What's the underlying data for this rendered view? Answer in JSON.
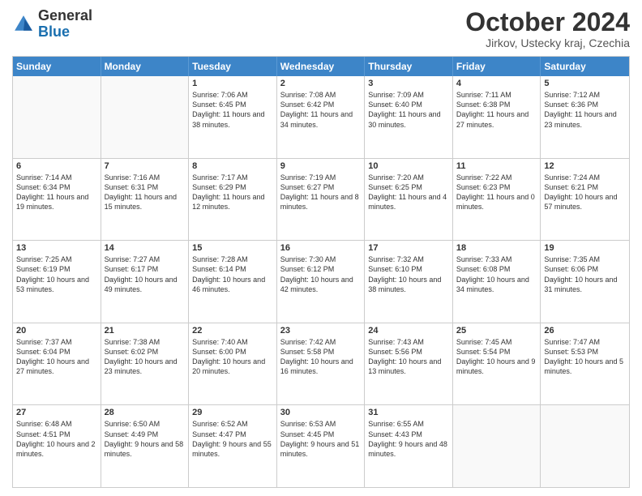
{
  "header": {
    "logo_general": "General",
    "logo_blue": "Blue",
    "month_title": "October 2024",
    "location": "Jirkov, Ustecky kraj, Czechia"
  },
  "days_of_week": [
    "Sunday",
    "Monday",
    "Tuesday",
    "Wednesday",
    "Thursday",
    "Friday",
    "Saturday"
  ],
  "weeks": [
    [
      {
        "day": "",
        "empty": true
      },
      {
        "day": "",
        "empty": true
      },
      {
        "day": "1",
        "sunrise": "Sunrise: 7:06 AM",
        "sunset": "Sunset: 6:45 PM",
        "daylight": "Daylight: 11 hours and 38 minutes."
      },
      {
        "day": "2",
        "sunrise": "Sunrise: 7:08 AM",
        "sunset": "Sunset: 6:42 PM",
        "daylight": "Daylight: 11 hours and 34 minutes."
      },
      {
        "day": "3",
        "sunrise": "Sunrise: 7:09 AM",
        "sunset": "Sunset: 6:40 PM",
        "daylight": "Daylight: 11 hours and 30 minutes."
      },
      {
        "day": "4",
        "sunrise": "Sunrise: 7:11 AM",
        "sunset": "Sunset: 6:38 PM",
        "daylight": "Daylight: 11 hours and 27 minutes."
      },
      {
        "day": "5",
        "sunrise": "Sunrise: 7:12 AM",
        "sunset": "Sunset: 6:36 PM",
        "daylight": "Daylight: 11 hours and 23 minutes."
      }
    ],
    [
      {
        "day": "6",
        "sunrise": "Sunrise: 7:14 AM",
        "sunset": "Sunset: 6:34 PM",
        "daylight": "Daylight: 11 hours and 19 minutes."
      },
      {
        "day": "7",
        "sunrise": "Sunrise: 7:16 AM",
        "sunset": "Sunset: 6:31 PM",
        "daylight": "Daylight: 11 hours and 15 minutes."
      },
      {
        "day": "8",
        "sunrise": "Sunrise: 7:17 AM",
        "sunset": "Sunset: 6:29 PM",
        "daylight": "Daylight: 11 hours and 12 minutes."
      },
      {
        "day": "9",
        "sunrise": "Sunrise: 7:19 AM",
        "sunset": "Sunset: 6:27 PM",
        "daylight": "Daylight: 11 hours and 8 minutes."
      },
      {
        "day": "10",
        "sunrise": "Sunrise: 7:20 AM",
        "sunset": "Sunset: 6:25 PM",
        "daylight": "Daylight: 11 hours and 4 minutes."
      },
      {
        "day": "11",
        "sunrise": "Sunrise: 7:22 AM",
        "sunset": "Sunset: 6:23 PM",
        "daylight": "Daylight: 11 hours and 0 minutes."
      },
      {
        "day": "12",
        "sunrise": "Sunrise: 7:24 AM",
        "sunset": "Sunset: 6:21 PM",
        "daylight": "Daylight: 10 hours and 57 minutes."
      }
    ],
    [
      {
        "day": "13",
        "sunrise": "Sunrise: 7:25 AM",
        "sunset": "Sunset: 6:19 PM",
        "daylight": "Daylight: 10 hours and 53 minutes."
      },
      {
        "day": "14",
        "sunrise": "Sunrise: 7:27 AM",
        "sunset": "Sunset: 6:17 PM",
        "daylight": "Daylight: 10 hours and 49 minutes."
      },
      {
        "day": "15",
        "sunrise": "Sunrise: 7:28 AM",
        "sunset": "Sunset: 6:14 PM",
        "daylight": "Daylight: 10 hours and 46 minutes."
      },
      {
        "day": "16",
        "sunrise": "Sunrise: 7:30 AM",
        "sunset": "Sunset: 6:12 PM",
        "daylight": "Daylight: 10 hours and 42 minutes."
      },
      {
        "day": "17",
        "sunrise": "Sunrise: 7:32 AM",
        "sunset": "Sunset: 6:10 PM",
        "daylight": "Daylight: 10 hours and 38 minutes."
      },
      {
        "day": "18",
        "sunrise": "Sunrise: 7:33 AM",
        "sunset": "Sunset: 6:08 PM",
        "daylight": "Daylight: 10 hours and 34 minutes."
      },
      {
        "day": "19",
        "sunrise": "Sunrise: 7:35 AM",
        "sunset": "Sunset: 6:06 PM",
        "daylight": "Daylight: 10 hours and 31 minutes."
      }
    ],
    [
      {
        "day": "20",
        "sunrise": "Sunrise: 7:37 AM",
        "sunset": "Sunset: 6:04 PM",
        "daylight": "Daylight: 10 hours and 27 minutes."
      },
      {
        "day": "21",
        "sunrise": "Sunrise: 7:38 AM",
        "sunset": "Sunset: 6:02 PM",
        "daylight": "Daylight: 10 hours and 23 minutes."
      },
      {
        "day": "22",
        "sunrise": "Sunrise: 7:40 AM",
        "sunset": "Sunset: 6:00 PM",
        "daylight": "Daylight: 10 hours and 20 minutes."
      },
      {
        "day": "23",
        "sunrise": "Sunrise: 7:42 AM",
        "sunset": "Sunset: 5:58 PM",
        "daylight": "Daylight: 10 hours and 16 minutes."
      },
      {
        "day": "24",
        "sunrise": "Sunrise: 7:43 AM",
        "sunset": "Sunset: 5:56 PM",
        "daylight": "Daylight: 10 hours and 13 minutes."
      },
      {
        "day": "25",
        "sunrise": "Sunrise: 7:45 AM",
        "sunset": "Sunset: 5:54 PM",
        "daylight": "Daylight: 10 hours and 9 minutes."
      },
      {
        "day": "26",
        "sunrise": "Sunrise: 7:47 AM",
        "sunset": "Sunset: 5:53 PM",
        "daylight": "Daylight: 10 hours and 5 minutes."
      }
    ],
    [
      {
        "day": "27",
        "sunrise": "Sunrise: 6:48 AM",
        "sunset": "Sunset: 4:51 PM",
        "daylight": "Daylight: 10 hours and 2 minutes."
      },
      {
        "day": "28",
        "sunrise": "Sunrise: 6:50 AM",
        "sunset": "Sunset: 4:49 PM",
        "daylight": "Daylight: 9 hours and 58 minutes."
      },
      {
        "day": "29",
        "sunrise": "Sunrise: 6:52 AM",
        "sunset": "Sunset: 4:47 PM",
        "daylight": "Daylight: 9 hours and 55 minutes."
      },
      {
        "day": "30",
        "sunrise": "Sunrise: 6:53 AM",
        "sunset": "Sunset: 4:45 PM",
        "daylight": "Daylight: 9 hours and 51 minutes."
      },
      {
        "day": "31",
        "sunrise": "Sunrise: 6:55 AM",
        "sunset": "Sunset: 4:43 PM",
        "daylight": "Daylight: 9 hours and 48 minutes."
      },
      {
        "day": "",
        "empty": true
      },
      {
        "day": "",
        "empty": true
      }
    ]
  ]
}
